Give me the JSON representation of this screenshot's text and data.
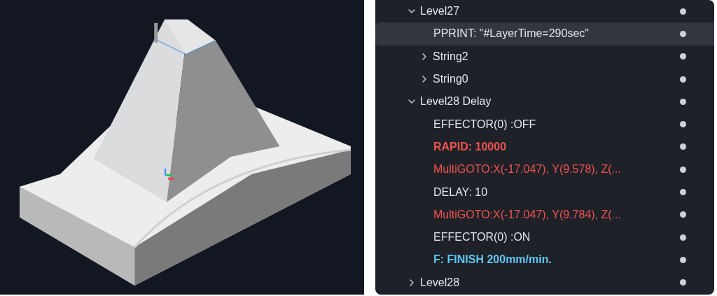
{
  "tree": [
    {
      "label": "Level27",
      "kind": "command",
      "expanded": true,
      "selected": false,
      "children": [
        {
          "label": "PPRINT: \"#LayerTime=290sec\"",
          "kind": "command",
          "selected": true
        },
        {
          "label": "String2",
          "kind": "command",
          "expanded": false,
          "selected": false
        },
        {
          "label": "String0",
          "kind": "command",
          "expanded": false,
          "selected": false
        }
      ]
    },
    {
      "label": "Level28 Delay",
      "kind": "command",
      "expanded": true,
      "selected": false,
      "children": [
        {
          "label": "EFFECTOR(0) :OFF",
          "kind": "command",
          "selected": false
        },
        {
          "label": "RAPID: 10000",
          "kind": "rapid",
          "selected": false
        },
        {
          "label": "MultiGOTO:X(-17.047), Y(9.578), Z(...",
          "kind": "move",
          "selected": false
        },
        {
          "label": "DELAY: 10",
          "kind": "command",
          "selected": false
        },
        {
          "label": "MultiGOTO:X(-17.047), Y(9.784), Z(...",
          "kind": "move",
          "selected": false
        },
        {
          "label": "EFFECTOR(0) :ON",
          "kind": "command",
          "selected": false
        },
        {
          "label": "F: FINISH 200mm/min.",
          "kind": "feed",
          "selected": false
        }
      ]
    },
    {
      "label": "Level28",
      "kind": "command",
      "expanded": false,
      "selected": false
    }
  ]
}
